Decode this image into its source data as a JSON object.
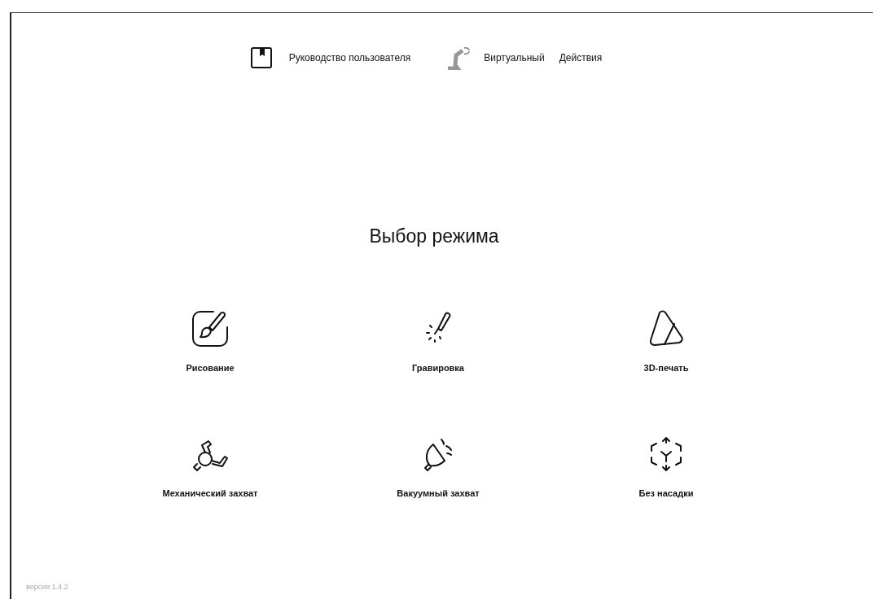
{
  "header": {
    "items": [
      {
        "kind": "manual",
        "label": "Руководство пользователя"
      },
      {
        "kind": "robot",
        "label": "Виртуальный"
      },
      {
        "kind": "text",
        "label": "Действия"
      }
    ]
  },
  "title": "Выбор режима",
  "modes": [
    {
      "kind": "drawing",
      "label": "Рисование"
    },
    {
      "kind": "engraving",
      "label": "Гравировка"
    },
    {
      "kind": "print3d",
      "label": "3D-печать"
    },
    {
      "kind": "gripper",
      "label": "Механический захват"
    },
    {
      "kind": "vacuum",
      "label": "Вакуумный захват"
    },
    {
      "kind": "none",
      "label": "Без насадки"
    }
  ],
  "version": "версия 1.4.2"
}
